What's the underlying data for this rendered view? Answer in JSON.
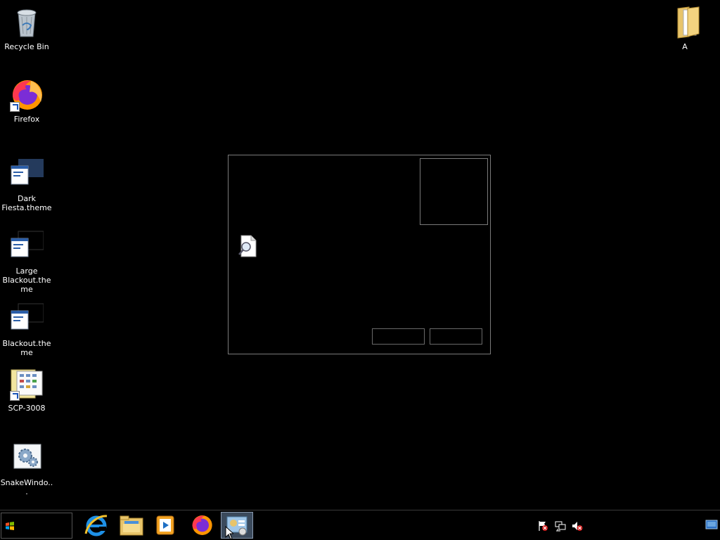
{
  "desktop": {
    "icons": [
      {
        "label": "Recycle Bin",
        "icon": "recycle-bin-icon"
      },
      {
        "label": "Firefox",
        "icon": "firefox-icon"
      },
      {
        "label": "Dark\nFiesta.theme",
        "icon": "theme-file-icon"
      },
      {
        "label": "Large\nBlackout.theme",
        "icon": "theme-file-icon"
      },
      {
        "label": "Blackout.theme",
        "icon": "theme-file-icon"
      },
      {
        "label": "SCP-3008",
        "icon": "control-panel-shortcut-icon"
      },
      {
        "label": "SnakeWindo...",
        "icon": "settings-gear-icon"
      },
      {
        "label": "A",
        "icon": "folder-icon"
      }
    ]
  },
  "dialog": {
    "ok_label": "",
    "cancel_label": ""
  },
  "taskbar": {
    "apps": [
      {
        "name": "Internet Explorer",
        "icon": "internet-explorer-icon"
      },
      {
        "name": "File Explorer",
        "icon": "file-explorer-icon"
      },
      {
        "name": "Windows Media Player",
        "icon": "media-player-icon"
      },
      {
        "name": "Firefox",
        "icon": "firefox-icon"
      },
      {
        "name": "Display Settings",
        "icon": "display-settings-icon"
      }
    ],
    "tray": [
      "action-center-flag-icon",
      "network-icon",
      "volume-muted-icon"
    ]
  },
  "colors": {
    "desktop_bg": "#000000",
    "dialog_border": "#7a7a7a",
    "taskbar_bg": "#000000",
    "active_app_bg": "#3b4a5c"
  }
}
